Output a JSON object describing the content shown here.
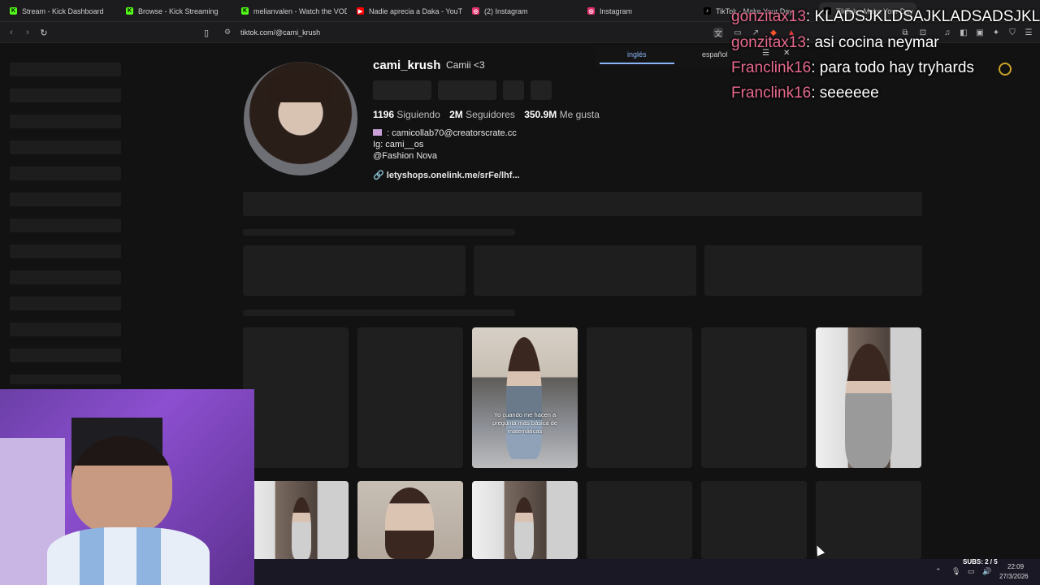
{
  "tabs": [
    {
      "title": "Stream - Kick Dashboard",
      "icon": "kick-icon",
      "color": "#53fc18"
    },
    {
      "title": "Browse - Kick Streaming",
      "icon": "kick-icon",
      "color": "#53fc18"
    },
    {
      "title": "melianvalen - Watch the VOD",
      "icon": "kick-icon",
      "color": "#53fc18"
    },
    {
      "title": "Nadie aprecia a Daka - YouTube",
      "icon": "youtube-icon",
      "color": "#ff0000"
    },
    {
      "title": "(2) Instagram",
      "icon": "instagram-icon",
      "color": "#e1306c"
    },
    {
      "title": "Instagram",
      "icon": "instagram-icon",
      "color": "#e1306c"
    },
    {
      "title": "TikTok - Make Your Day",
      "icon": "tiktok-icon",
      "color": "#ffffff"
    },
    {
      "title": "TikTok - Make Your Day",
      "icon": "tiktok-icon",
      "color": "#ffffff"
    }
  ],
  "address_bar": {
    "url": "tiktok.com/@cami_krush"
  },
  "translate": {
    "option_1": "inglés",
    "option_2": "español"
  },
  "profile": {
    "username": "cami_krush",
    "display_name": "Camii <3",
    "following_count": "1196",
    "following_label": "Siguiendo",
    "followers_count": "2M",
    "followers_label": "Seguidores",
    "likes_count": "350.9M",
    "likes_label": "Me gusta",
    "bio_line_1": ": camicollab70@creatorscrate.cc",
    "bio_line_2": "Ig: cami__os",
    "bio_line_3": "@Fashion Nova",
    "link": "letyshops.onelink.me/srFe/lhf..."
  },
  "video_caption": "Yo cuando me hacen a pregunta más básica de matemáticas",
  "chat": [
    {
      "user": "gonzitax13",
      "message": "KLADSJKLDSAJKLADSADSJKLSK"
    },
    {
      "user": "gonzitax13",
      "message": "asi cocina neymar"
    },
    {
      "user": "Franclink16",
      "message": "para todo hay tryhards"
    },
    {
      "user": "Franclink16",
      "message": "seeeeee"
    }
  ],
  "overlay": {
    "subs": "SUBS: 2 / 5"
  },
  "clock": {
    "time": "22:09",
    "date": "27/3/2026"
  },
  "colors": {
    "accent": "#e86a8e",
    "background": "#121212"
  }
}
